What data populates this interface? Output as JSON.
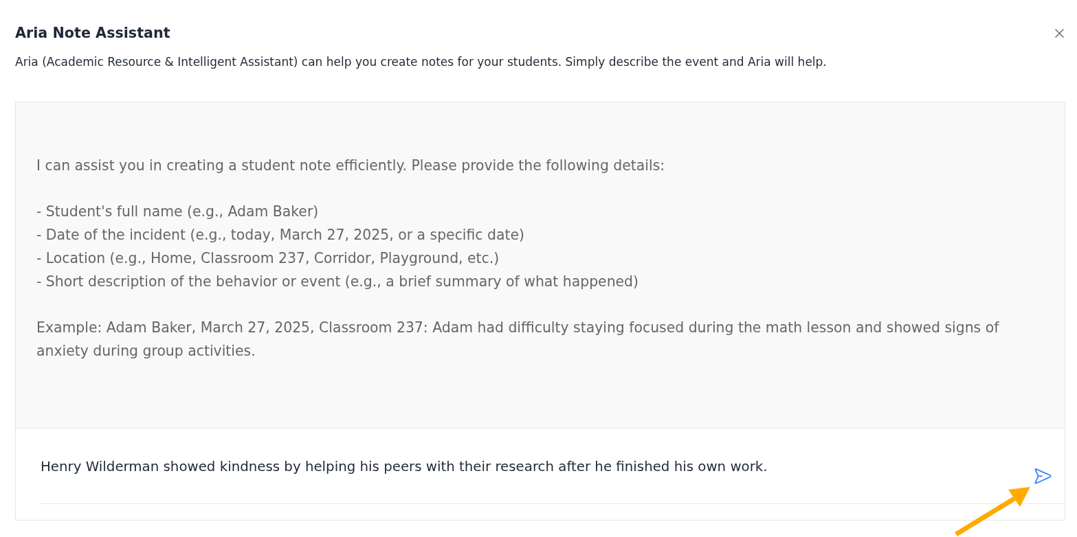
{
  "dialog": {
    "title": "Aria Note Assistant",
    "subtitle": "Aria (Academic Resource & Intelligent Assistant) can help you create notes for your students. Simply describe the event and Aria will help."
  },
  "assistant_message": {
    "intro": "I can assist you in creating a student note efficiently. Please provide the following details:",
    "list_items": [
      "- Student's full name (e.g., Adam Baker)",
      "- Date of the incident (e.g., today, March 27, 2025, or a specific date)",
      "- Location (e.g., Home, Classroom 237, Corridor, Playground, etc.)",
      "- Short description of the behavior or event (e.g., a brief summary of what happened)"
    ],
    "example": "Example: Adam Baker, March 27, 2025, Classroom 237: Adam had difficulty staying focused during the math lesson and showed signs of anxiety during group activities."
  },
  "composer": {
    "value": "Henry Wilderman showed kindness by helping his peers with their research after he finished his own work."
  },
  "annotations": [
    {
      "kind": "arrow"
    }
  ]
}
